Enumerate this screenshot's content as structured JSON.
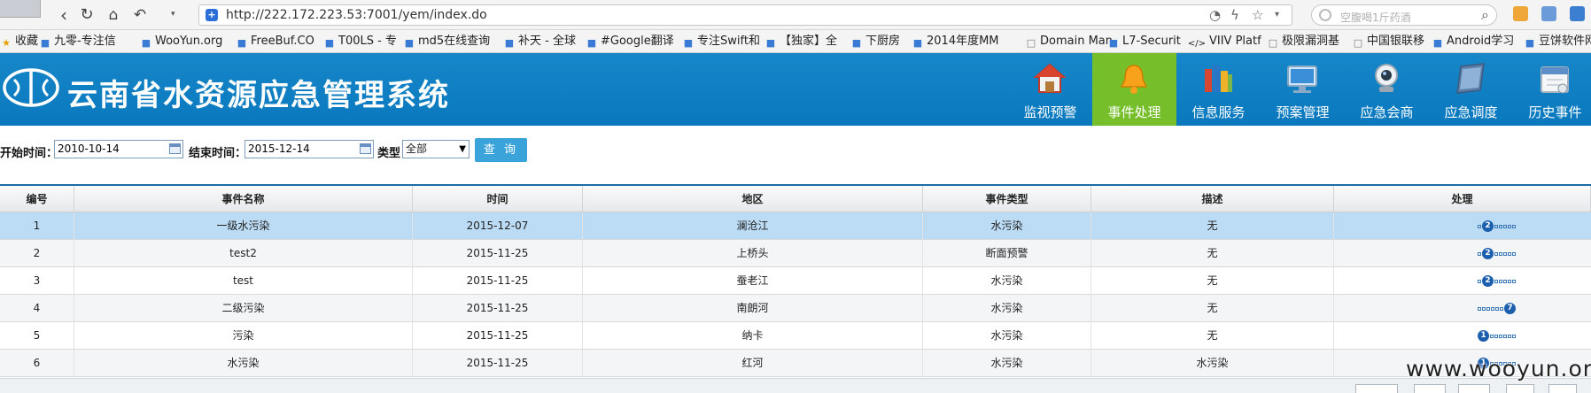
{
  "browser": {
    "url": "http://222.172.223.53:7001/yem/index.do",
    "search_placeholder": "空腹喝1斤药酒",
    "bookmarks": [
      {
        "label": "收藏",
        "icon": "star-icon"
      },
      {
        "label": "九零-专注信",
        "icon": "bookmark-icon"
      },
      {
        "label": "WooYun.org",
        "icon": "bookmark-icon"
      },
      {
        "label": "FreeBuf.CO",
        "icon": "bookmark-icon"
      },
      {
        "label": "T00LS - 专",
        "icon": "bookmark-icon"
      },
      {
        "label": "md5在线查询",
        "icon": "bookmark-icon"
      },
      {
        "label": "补天 - 全球",
        "icon": "bookmark-icon"
      },
      {
        "label": "#Google翻译",
        "icon": "bookmark-icon"
      },
      {
        "label": "专注Swift和",
        "icon": "bookmark-icon"
      },
      {
        "label": "【独家】全",
        "icon": "bookmark-icon"
      },
      {
        "label": "下厨房",
        "icon": "bookmark-icon"
      },
      {
        "label": "2014年度MM",
        "icon": "bookmark-icon"
      },
      {
        "label": "Domain Man",
        "icon": "page-icon"
      },
      {
        "label": "L7-Securit",
        "icon": "bookmark-icon"
      },
      {
        "label": "VIIV Platf",
        "icon": "code-icon"
      },
      {
        "label": "极限漏洞基",
        "icon": "page-icon"
      },
      {
        "label": "中国银联移",
        "icon": "page-icon"
      },
      {
        "label": "Android学习",
        "icon": "bookmark-icon"
      },
      {
        "label": "豆饼软件网",
        "icon": "bookmark-icon"
      }
    ]
  },
  "app": {
    "title": "云南省水资源应急管理系统",
    "nav": [
      {
        "label": "监视预警",
        "icon": "house-icon",
        "active": false
      },
      {
        "label": "事件处理",
        "icon": "bell-icon",
        "active": true
      },
      {
        "label": "信息服务",
        "icon": "books-icon",
        "active": false
      },
      {
        "label": "预案管理",
        "icon": "monitor-icon",
        "active": false
      },
      {
        "label": "应急会商",
        "icon": "webcam-icon",
        "active": false
      },
      {
        "label": "应急调度",
        "icon": "notebook-icon",
        "active": false
      },
      {
        "label": "历史事件",
        "icon": "calendar-icon",
        "active": false
      }
    ]
  },
  "filter": {
    "start_label": "开始时间：",
    "start_value": "2010-10-14",
    "end_label": "结束时间：",
    "end_value": "2015-12-14",
    "type_label": "类型",
    "type_value": "全部",
    "query_button": "查 询"
  },
  "table": {
    "columns": [
      "编号",
      "事件名称",
      "时间",
      "地区",
      "事件类型",
      "描述",
      "处理"
    ],
    "rows": [
      {
        "id": "1",
        "name": "一级水污染",
        "time": "2015-12-07",
        "region": "澜沧江",
        "type": "水污染",
        "desc": "无",
        "step_badge": "2",
        "step_index": 1,
        "selected": true
      },
      {
        "id": "2",
        "name": "test2",
        "time": "2015-11-25",
        "region": "上桥头",
        "type": "断面预警",
        "desc": "无",
        "step_badge": "2",
        "step_index": 1,
        "selected": false
      },
      {
        "id": "3",
        "name": "test",
        "time": "2015-11-25",
        "region": "蚕老江",
        "type": "水污染",
        "desc": "无",
        "step_badge": "2",
        "step_index": 1,
        "selected": false
      },
      {
        "id": "4",
        "name": "二级污染",
        "time": "2015-11-25",
        "region": "南朗河",
        "type": "水污染",
        "desc": "无",
        "step_badge": "7",
        "step_index": 6,
        "selected": false
      },
      {
        "id": "5",
        "name": "污染",
        "time": "2015-11-25",
        "region": "纳卡",
        "type": "水污染",
        "desc": "无",
        "step_badge": "1",
        "step_index": 0,
        "selected": false
      },
      {
        "id": "6",
        "name": "水污染",
        "time": "2015-11-25",
        "region": "红河",
        "type": "水污染",
        "desc": "水污染",
        "step_badge": "1",
        "step_index": 0,
        "selected": false
      }
    ]
  },
  "watermark": "www.wooyun.org",
  "colors": {
    "header_blue": "#0a78bd",
    "active_tab_green": "#77bf2a",
    "selected_row": "#bcdcf6",
    "query_button": "#3aa3d9",
    "step_badge": "#1c5fae"
  }
}
